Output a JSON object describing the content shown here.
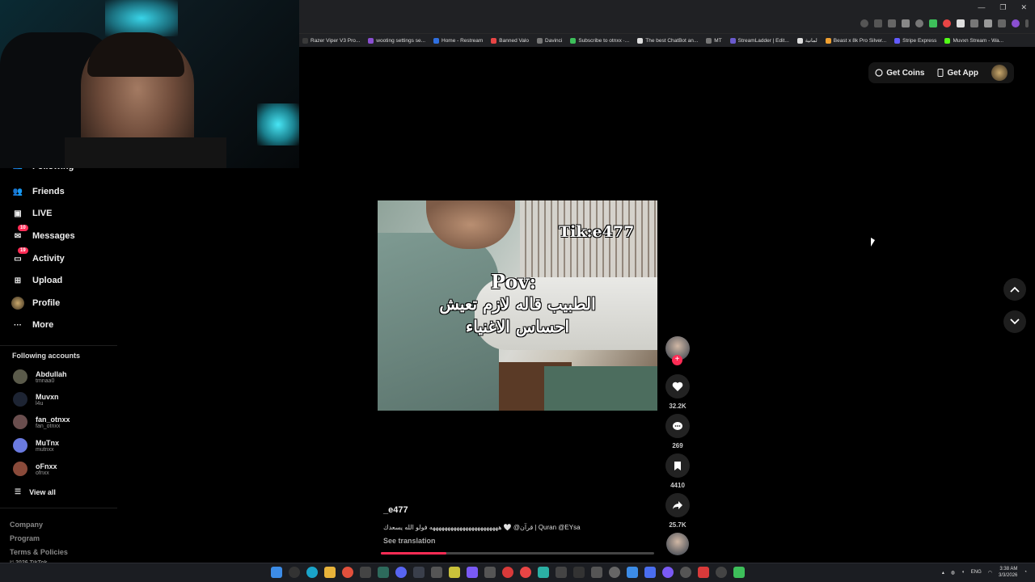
{
  "browser": {
    "window_controls": [
      "—",
      "❐",
      "✕"
    ],
    "bookmarks": [
      {
        "label": "Razer Viper V3 Pro...",
        "color": "#3a3a3a"
      },
      {
        "label": "wooting settings se...",
        "color": "#8a4fd1"
      },
      {
        "label": "Home - Restream",
        "color": "#2f6fe0"
      },
      {
        "label": "Banned Valo",
        "color": "#e84545"
      },
      {
        "label": "Davinci",
        "color": "#777777"
      },
      {
        "label": "Subscribe to otnxx ·...",
        "color": "#3dbf5a"
      },
      {
        "label": "The best ChatBot an...",
        "color": "#dddddd"
      },
      {
        "label": "MT",
        "color": "#777777"
      },
      {
        "label": "StreamLadder | Edit...",
        "color": "#6a5acd"
      },
      {
        "label": "لمانية",
        "color": "#dddddd"
      },
      {
        "label": "Beast x 8k Pro Silver...",
        "color": "#f0a030"
      },
      {
        "label": "Stripe Express",
        "color": "#635bff"
      },
      {
        "label": "Muvxn Stream - Wa...",
        "color": "#53fc18"
      }
    ]
  },
  "topbar": {
    "get_coins": "Get Coins",
    "get_app": "Get App"
  },
  "sidebar": {
    "nav": [
      {
        "label": "Following",
        "icon": "following-icon"
      },
      {
        "label": "Friends",
        "icon": "friends-icon"
      },
      {
        "label": "LIVE",
        "icon": "live-icon"
      },
      {
        "label": "Messages",
        "icon": "messages-icon",
        "badge": "10"
      },
      {
        "label": "Activity",
        "icon": "activity-icon",
        "badge": "19"
      },
      {
        "label": "Upload",
        "icon": "upload-icon"
      },
      {
        "label": "Profile",
        "icon": "profile-icon"
      },
      {
        "label": "More",
        "icon": "more-icon"
      }
    ],
    "following_title": "Following accounts",
    "accounts": [
      {
        "name": "Abdullah",
        "handle": "tmnaa0",
        "color": "#5a5a4a"
      },
      {
        "name": "Muvxn",
        "handle": "l4u",
        "color": "#1d2433"
      },
      {
        "name": "fan_otnxx",
        "handle": "fan_otnxx",
        "color": "#6a4e4e"
      },
      {
        "name": "MuTnx",
        "handle": "mutnxx",
        "color": "#6a7ae0"
      },
      {
        "name": "oFnxx",
        "handle": "ofnxx",
        "color": "#8a4a3a"
      }
    ],
    "view_all": "View all",
    "footer": [
      "Company",
      "Program",
      "Terms & Policies",
      "© 2026 TikTok"
    ]
  },
  "video": {
    "watermark": "Tik:e477",
    "line1": "Pov:",
    "line2": "الطبيب قاله لازم تعيش",
    "line3": "احساس الاغنياء",
    "author": "_e477",
    "caption": "قرآن@ 🤍 هههههههههههههههههههههههه فولو الله يسعدك | Quran @EYsa",
    "see_translation": "See translation",
    "progress": 0.24
  },
  "actions": {
    "likes": "32.2K",
    "comments": "269",
    "saves": "4410",
    "shares": "25.7K"
  },
  "taskbar": {
    "lang": "ENG",
    "time": "3:38 AM",
    "date": "3/3/2026"
  }
}
